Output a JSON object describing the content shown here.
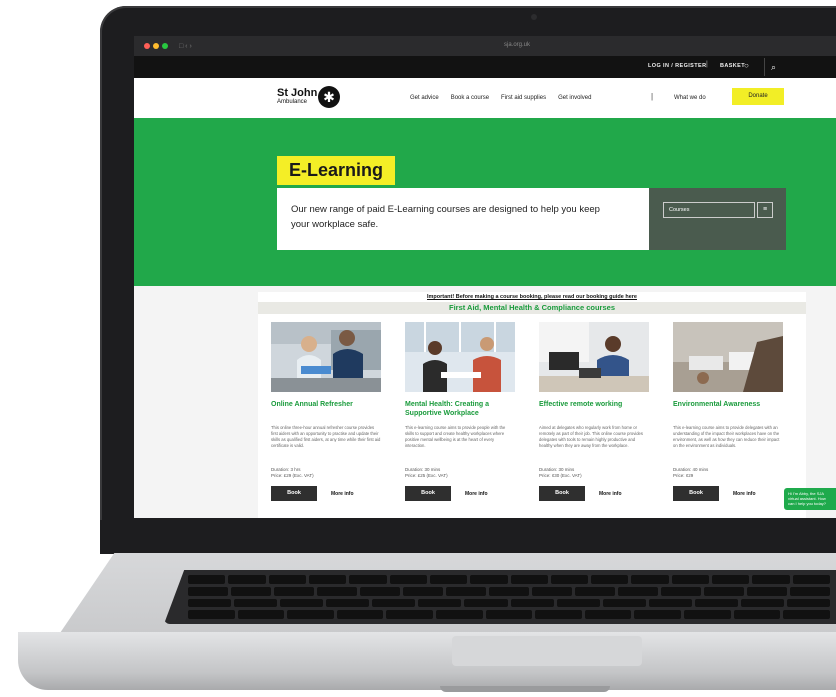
{
  "browser": {
    "url": "sja.org.uk",
    "controls": "□ ‹ ›"
  },
  "utility": {
    "login": "LOG IN / REGISTER",
    "separator": "|",
    "basket": "BASKET",
    "bag_icon": "👜",
    "search_icon": "⌕"
  },
  "nav": {
    "logo_line1": "St John",
    "logo_line2": "Ambulance",
    "logo_icon": "✱",
    "links": [
      "Get advice",
      "Book a course",
      "First aid supplies",
      "Get involved"
    ],
    "divider": "|",
    "what_we_do": "What we do",
    "donate": "Donate"
  },
  "hero": {
    "title": "E-Learning",
    "text": "Our new range of paid E-Learning courses are designed to help you keep your workplace safe.",
    "select_value": "Courses",
    "select_icon": "≡"
  },
  "content": {
    "important": "Important! Before making a course booking, please read our booking guide here",
    "section_title": "First Aid, Mental Health & Compliance courses",
    "cards": [
      {
        "title": "Online Annual Refresher",
        "desc": "This online three-hour annual refresher course provides first aiders with an opportunity to practise and update their skills as qualified first aiders, at any time while their first aid certificate is valid.",
        "duration": "Duration: 3 hrs",
        "price": "Price:    £29 (Exc. VAT)",
        "book": "Book",
        "more": "More info"
      },
      {
        "title": "Mental Health: Creating a Supportive Workplace",
        "desc": "This e-learning course aims to provide people with the skills to support and create healthy workplaces where positive mental wellbeing is at the heart of every interaction.",
        "duration": "Duration: 30 mins",
        "price": "Price:    £25 (Exc. VAT)",
        "book": "Book",
        "more": "More info"
      },
      {
        "title": "Effective remote working",
        "desc": "Aimed at delegates who regularly work from home or remotely as part of their job. This online course provides delegates with tools to remain highly productive and healthy when they are away from the workplace.",
        "duration": "Duration: 30 mins",
        "price": "Price:    ¢30 (Exc. VAT)",
        "book": "Book",
        "more": "More info"
      },
      {
        "title": "Environmental Awareness",
        "desc": "This e-learning course aims to provide delegates with an understanding of the impact their workplaces have on the environment, as well as how they can reduce their impact on the environment as individuals.",
        "duration": "Duration: 40 mins",
        "price": "Price:    ¢29",
        "book": "Book",
        "more": "More info"
      }
    ]
  },
  "chat": {
    "text": "Hi I'm Abby, the SJA virtual assistant. How can I help you today?"
  },
  "colors": {
    "brand_green": "#21a84a",
    "accent_yellow": "#f4ee26"
  }
}
